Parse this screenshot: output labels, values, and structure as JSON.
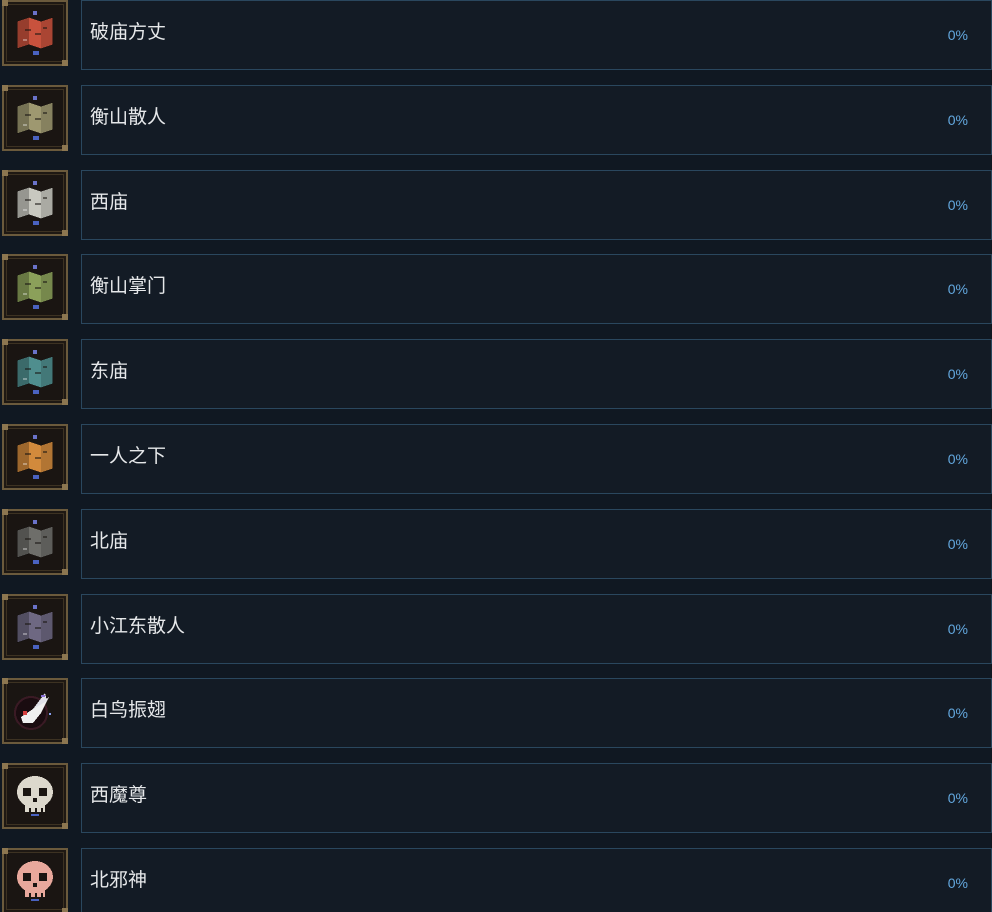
{
  "achievements": [
    {
      "name": "破庙方丈",
      "percent": "0%",
      "icon": "red-map-scroll-icon",
      "color": "#c8523d"
    },
    {
      "name": "衡山散人",
      "percent": "0%",
      "icon": "olive-map-scroll-icon",
      "color": "#9e9870"
    },
    {
      "name": "西庙",
      "percent": "0%",
      "icon": "white-map-scroll-icon",
      "color": "#c8c8c0"
    },
    {
      "name": "衡山掌门",
      "percent": "0%",
      "icon": "green-map-scroll-icon",
      "color": "#8ba05a"
    },
    {
      "name": "东庙",
      "percent": "0%",
      "icon": "teal-map-scroll-icon",
      "color": "#4f8e8e"
    },
    {
      "name": "一人之下",
      "percent": "0%",
      "icon": "orange-map-scroll-icon",
      "color": "#d28a3c"
    },
    {
      "name": "北庙",
      "percent": "0%",
      "icon": "gray-map-scroll-icon",
      "color": "#6e6e6a"
    },
    {
      "name": "小江东散人",
      "percent": "0%",
      "icon": "purple-map-scroll-icon",
      "color": "#6e6882"
    },
    {
      "name": "白鸟振翅",
      "percent": "0%",
      "icon": "white-bird-icon",
      "color": "#e8e8e8"
    },
    {
      "name": "西魔尊",
      "percent": "0%",
      "icon": "white-skull-icon",
      "color": "#dcd8cc"
    },
    {
      "name": "北邪神",
      "percent": "0%",
      "icon": "pink-skull-icon",
      "color": "#e8a89c"
    }
  ]
}
